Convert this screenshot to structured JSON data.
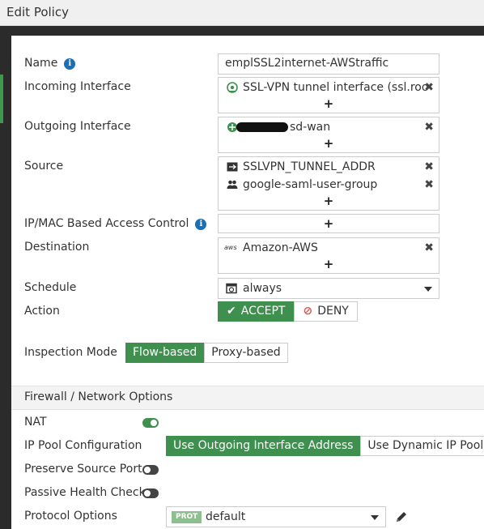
{
  "dialog": {
    "title": "Edit Policy"
  },
  "form": {
    "name": {
      "label": "Name",
      "value": "emplSSL2internet-AWStraffic"
    },
    "incoming_interface": {
      "label": "Incoming Interface",
      "entries": [
        {
          "text": "SSL-VPN tunnel interface (ssl.roo",
          "icon": "tunnel-icon"
        }
      ],
      "add": "+"
    },
    "outgoing_interface": {
      "label": "Outgoing Interface",
      "entries": [
        {
          "text": "sd-wan",
          "icon": "sd-wan-icon"
        }
      ],
      "add": "+"
    },
    "source": {
      "label": "Source",
      "entries": [
        {
          "text": "SSLVPN_TUNNEL_ADDR",
          "icon": "address-icon"
        },
        {
          "text": "google-saml-user-group",
          "icon": "user-group-icon"
        }
      ],
      "add": "+"
    },
    "ip_mac_access_control": {
      "label": "IP/MAC Based Access Control",
      "add": "+"
    },
    "destination": {
      "label": "Destination",
      "entries": [
        {
          "text": "Amazon-AWS",
          "icon": "aws-icon",
          "icon_text": "aws"
        }
      ],
      "add": "+"
    },
    "schedule": {
      "label": "Schedule",
      "value": "always"
    },
    "action": {
      "label": "Action",
      "accept": "ACCEPT",
      "deny": "DENY",
      "selected": "ACCEPT"
    },
    "inspection_mode": {
      "label": "Inspection Mode",
      "options": [
        "Flow-based",
        "Proxy-based"
      ],
      "selected": "Flow-based"
    }
  },
  "firewall_options": {
    "title": "Firewall / Network Options",
    "nat": {
      "label": "NAT",
      "enabled": true
    },
    "ip_pool": {
      "label": "IP Pool Configuration",
      "options": [
        "Use Outgoing Interface Address",
        "Use Dynamic IP Pool"
      ],
      "selected": "Use Outgoing Interface Address"
    },
    "preserve_source_port": {
      "label": "Preserve Source Port",
      "enabled": false
    },
    "passive_health_check": {
      "label": "Passive Health Check",
      "enabled": false
    },
    "protocol_options": {
      "label": "Protocol Options",
      "badge": "PROT",
      "value": "default"
    }
  },
  "colors": {
    "accent": "#3f8f4f",
    "info": "#1a6fb5",
    "deny": "#d9534f"
  }
}
